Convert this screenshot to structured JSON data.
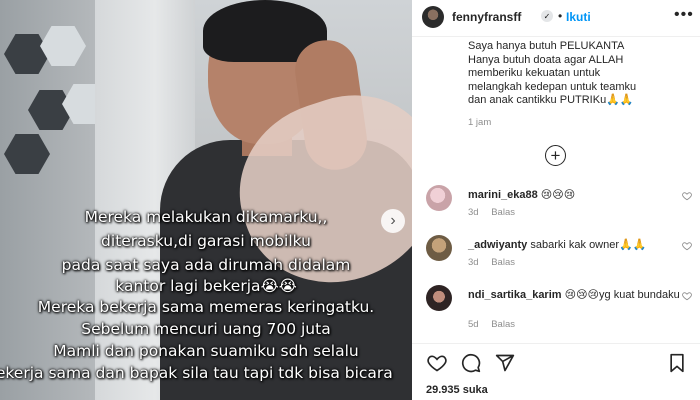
{
  "post": {
    "overlay_lines": [
      "Mereka melakukan dikamarku,,",
      "diterasku,di garasi mobilku",
      "pada saat saya ada dirumah didalam",
      "kantor lagi bekerja😭😭",
      "Mereka bekerja sama memeras keringatku.",
      "Sebelum mencuri uang 700 juta",
      "Mamli dan ponakan suamiku sdh selalu",
      "bekerja sama dan bapak sila tau tapi tdk bisa bicara"
    ],
    "carousel_next": "›"
  },
  "header": {
    "username": "fennyfransff",
    "verified_icon": "✓",
    "separator": "•",
    "follow_label": "Ikuti",
    "more_label": "•••"
  },
  "caption": {
    "lines": [
      "Saya hanya butuh PELUKANTA",
      "Hanya butuh doata agar ALLAH",
      "memberiku kekuatan untuk",
      "melangkah kedepan untuk teamku",
      "dan anak cantikku PUTRIKu🙏🙏"
    ],
    "time": "1 jam",
    "add_icon": "+"
  },
  "comments": [
    {
      "username": "marini_eka88",
      "text": "😢😢😢",
      "age": "3d",
      "reply": "Balas",
      "avatar_color": "#c9a3a8"
    },
    {
      "username": "_adwiyanty",
      "text": "sabarki kak owner🙏🙏",
      "age": "3d",
      "reply": "Balas",
      "avatar_color": "#8c7a5e"
    },
    {
      "username": "ndi_sartika_karim",
      "text": "😢😢😢yg kuat bundaku",
      "age": "5d",
      "reply": "Balas",
      "avatar_color": "#3d3030"
    }
  ],
  "actions": {
    "like_icon": "heart-icon",
    "comment_icon": "comment-icon",
    "share_icon": "share-icon",
    "save_icon": "bookmark-icon",
    "likes_count": "29.935 suka"
  },
  "colors": {
    "accent": "#0095f6",
    "meta": "#8e8e8e",
    "text": "#262626"
  }
}
